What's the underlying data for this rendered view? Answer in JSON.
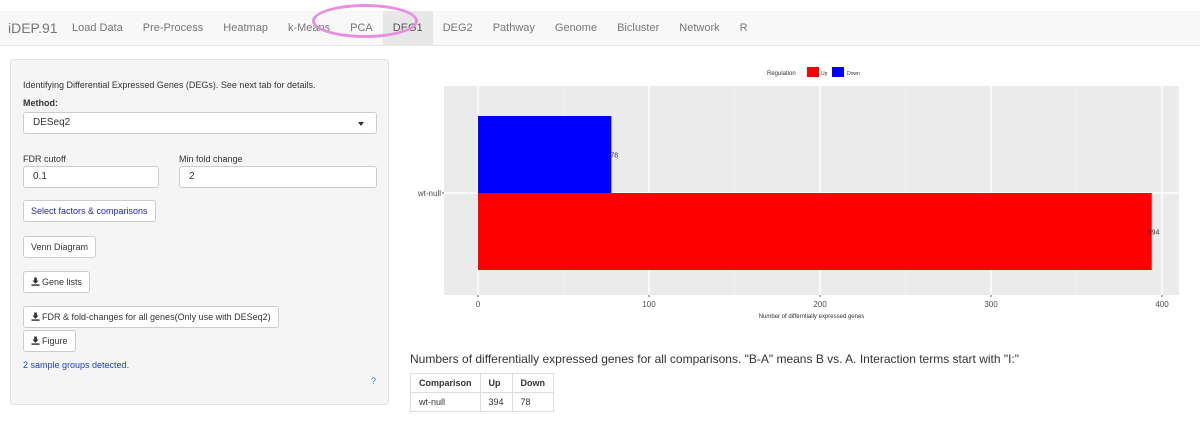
{
  "app": {
    "title": "iDEP.91"
  },
  "nav": {
    "tabs": [
      {
        "label": "Load Data"
      },
      {
        "label": "Pre-Process"
      },
      {
        "label": "Heatmap"
      },
      {
        "label": "k-Means"
      },
      {
        "label": "PCA"
      },
      {
        "label": "DEG1"
      },
      {
        "label": "DEG2"
      },
      {
        "label": "Pathway"
      },
      {
        "label": "Genome"
      },
      {
        "label": "Bicluster"
      },
      {
        "label": "Network"
      },
      {
        "label": "R"
      }
    ],
    "active_tab": "DEG1"
  },
  "sidebar": {
    "intro": "Identifying Differential Expressed Genes (DEGs). See next tab for details.",
    "method_label": "Method:",
    "method_value": "DESeq2",
    "fdr_label": "FDR cutoff",
    "fdr_value": "0.1",
    "fold_label": "Min fold change",
    "fold_value": "2",
    "select_factors_label": "Select factors & comparisons",
    "venn_label": "Venn Diagram",
    "gene_lists_label": "Gene lists",
    "fdr_fold_label": "FDR & fold-changes for all genes(Only use with DESeq2)",
    "figure_label": "Figure",
    "detected_text": "2 sample groups detected.",
    "help_text": "?"
  },
  "chart_data": {
    "type": "bar",
    "orientation": "horizontal",
    "categories": [
      "wt-null"
    ],
    "series": [
      {
        "name": "Up",
        "values": [
          394
        ],
        "color": "#ff0000"
      },
      {
        "name": "Down",
        "values": [
          78
        ],
        "color": "#0000ff"
      }
    ],
    "legend_title": "Regulation",
    "legend_position": "top",
    "xlabel": "Number of differntially expressed genes",
    "xlim": [
      0,
      410
    ],
    "xticks": [
      0,
      100,
      200,
      300,
      400
    ],
    "grid": true,
    "panel_color": "#ebebeb"
  },
  "results": {
    "caption": "Numbers of differentially expressed genes for all comparisons. \"B-A\" means B vs. A. Interaction terms start with \"I:\"",
    "columns": [
      "Comparison",
      "Up",
      "Down"
    ],
    "rows": [
      [
        "wt-null",
        "394",
        "78"
      ]
    ]
  }
}
